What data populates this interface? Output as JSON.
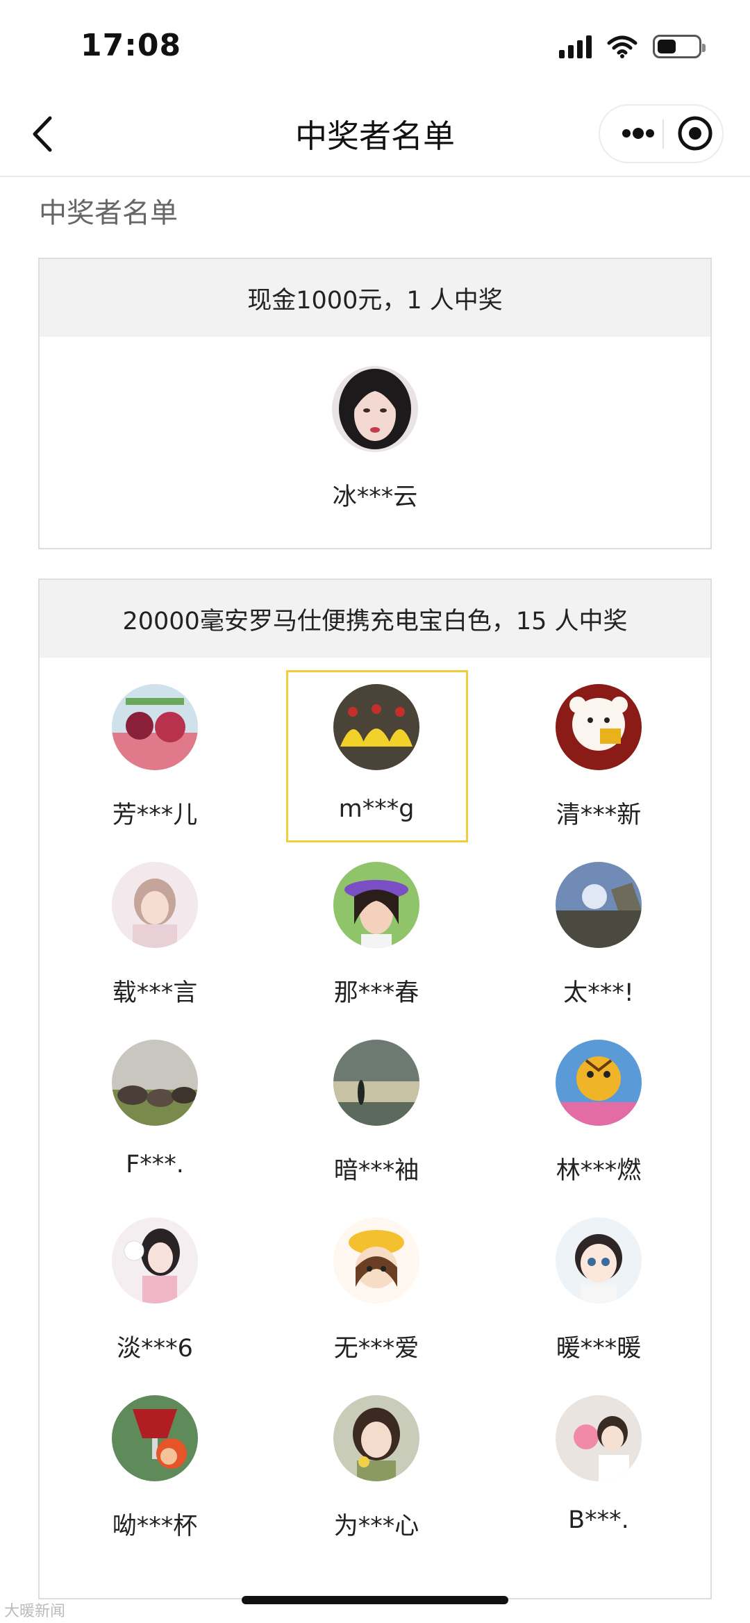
{
  "status_bar": {
    "time": "17:08"
  },
  "nav": {
    "title": "中奖者名单"
  },
  "page": {
    "section_title": "中奖者名单"
  },
  "prizes": [
    {
      "title": "现金1000元，1 人中奖",
      "winners": [
        {
          "name": "冰***云"
        }
      ]
    },
    {
      "title": "20000毫安罗马仕便携充电宝白色，15 人中奖",
      "winners": [
        {
          "name": "芳***儿"
        },
        {
          "name": "m***g"
        },
        {
          "name": "清***新"
        },
        {
          "name": "载***言"
        },
        {
          "name": "那***春"
        },
        {
          "name": "太***!"
        },
        {
          "name": "F***."
        },
        {
          "name": "暗***袖"
        },
        {
          "name": "林***燃"
        },
        {
          "name": "淡***6"
        },
        {
          "name": "无***爱"
        },
        {
          "name": "暖***暖"
        },
        {
          "name": "呦***杯"
        },
        {
          "name": "为***心"
        },
        {
          "name": "B***."
        }
      ]
    }
  ],
  "watermark": "大暖新闻",
  "colors": {
    "highlight": "#f0cd3a",
    "header_bg": "#f2f2f2"
  }
}
